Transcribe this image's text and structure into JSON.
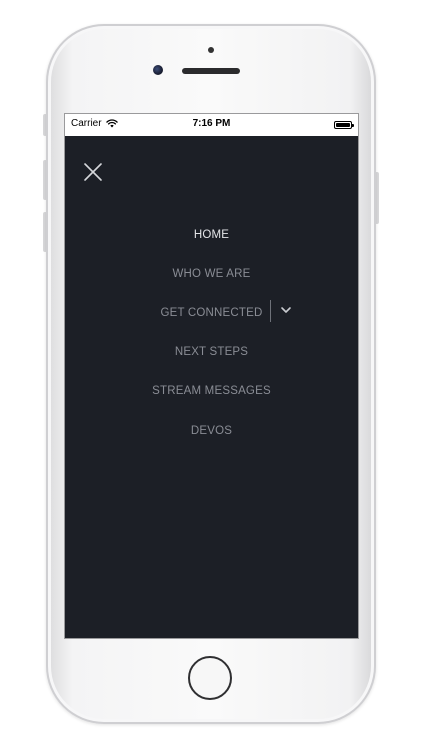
{
  "status_bar": {
    "carrier": "Carrier",
    "time": "7:16 PM",
    "icons": [
      "wifi-icon",
      "battery-icon"
    ]
  },
  "menu": {
    "close_icon": "close-icon",
    "items": [
      {
        "label": "HOME",
        "active": true
      },
      {
        "label": "WHO WE ARE",
        "active": false
      },
      {
        "label": "GET CONNECTED",
        "active": false,
        "expandable": true,
        "expand_icon": "chevron-down-icon"
      },
      {
        "label": "NEXT STEPS",
        "active": false
      },
      {
        "label": "STREAM MESSAGES",
        "active": false
      },
      {
        "label": "DEVOS",
        "active": false
      }
    ]
  },
  "colors": {
    "background": "#1c1f26",
    "active_text": "#e4e5e8",
    "inactive_text": "#8a8d95",
    "status_bar": "#ffffff"
  }
}
